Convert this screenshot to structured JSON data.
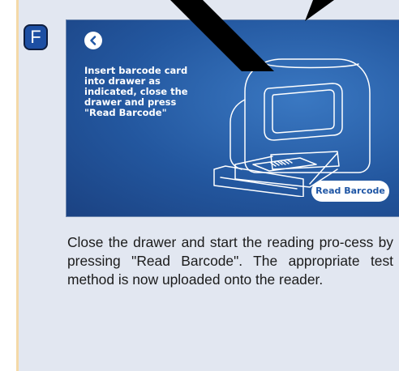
{
  "step": {
    "letter": "F"
  },
  "screen": {
    "instruction": "Insert barcode card\ninto drawer as\nindicated, close the\ndrawer and press\n\"Read Barcode\"",
    "read_button_label": "Read Barcode",
    "icons": {
      "back": "chevron-left-icon",
      "device": "reader-device-illustration"
    }
  },
  "description": "Close the drawer and start the reading pro-cess by pressing \"Read Barcode\". The appropriate test method is now uploaded onto the reader.",
  "colors": {
    "badge": "#1d4fa3",
    "screen_background": "#23579f",
    "button_text": "#1f56a5",
    "card_background": "#e2e7f1",
    "watermark": "#000000"
  }
}
